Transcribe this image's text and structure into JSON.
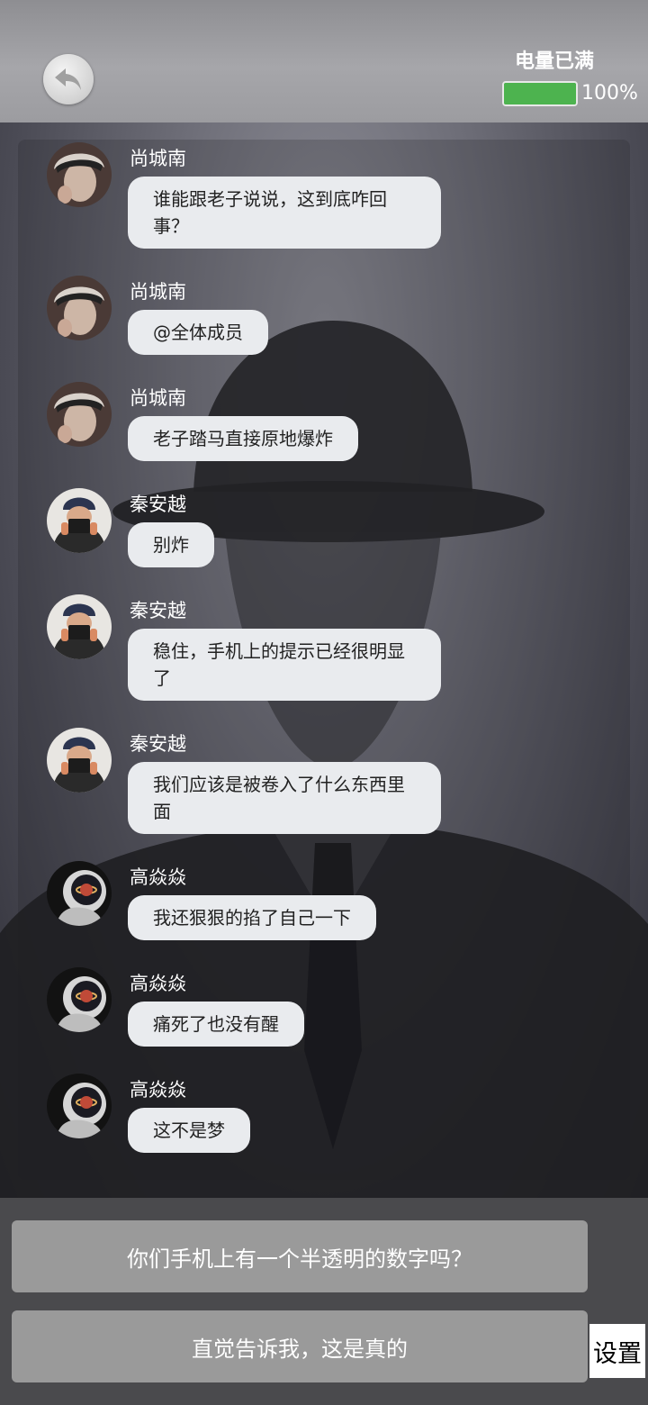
{
  "status": {
    "battery_label": "电量已满",
    "battery_percent_text": "100%",
    "battery_level": 1.0,
    "battery_color": "#4db34f"
  },
  "header": {
    "back_icon": "back-arrow-icon"
  },
  "messages": [
    {
      "sender": "尚城南",
      "text": "谁能跟老子说说，这到底咋回事？",
      "avatar": "avatar-boy-white-hair"
    },
    {
      "sender": "尚城南",
      "text": "@全体成员",
      "avatar": "avatar-boy-white-hair"
    },
    {
      "sender": "尚城南",
      "text": "老子踏马直接原地爆炸",
      "avatar": "avatar-boy-white-hair"
    },
    {
      "sender": "秦安越",
      "text": "别炸",
      "avatar": "avatar-boy-camera"
    },
    {
      "sender": "秦安越",
      "text": "稳住，手机上的提示已经很明显了",
      "avatar": "avatar-boy-camera"
    },
    {
      "sender": "秦安越",
      "text": "我们应该是被卷入了什么东西里面",
      "avatar": "avatar-boy-camera"
    },
    {
      "sender": "高焱焱",
      "text": "我还狠狠的掐了自己一下",
      "avatar": "avatar-astronaut"
    },
    {
      "sender": "高焱焱",
      "text": "痛死了也没有醒",
      "avatar": "avatar-astronaut"
    },
    {
      "sender": "高焱焱",
      "text": "这不是梦",
      "avatar": "avatar-astronaut"
    }
  ],
  "choices": [
    {
      "label": "你们手机上有一个半透明的数字吗？"
    },
    {
      "label": "直觉告诉我，这是真的"
    }
  ],
  "settings": {
    "label": "设置"
  }
}
